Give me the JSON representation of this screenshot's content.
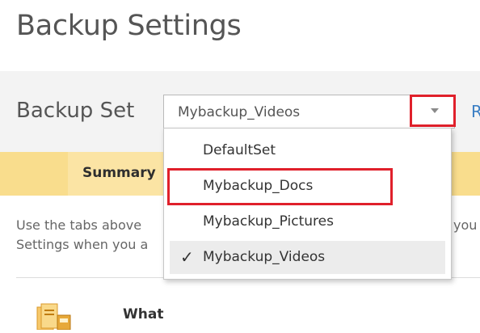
{
  "page": {
    "title": "Backup Settings"
  },
  "backup_set": {
    "label": "Backup Set",
    "selected_value": "Mybackup_Videos",
    "options": [
      {
        "label": "DefaultSet",
        "checked": false
      },
      {
        "label": "Mybackup_Docs",
        "checked": false
      },
      {
        "label": "Mybackup_Pictures",
        "checked": false
      },
      {
        "label": "Mybackup_Videos",
        "checked": true
      }
    ],
    "check_glyph": "✓"
  },
  "side_link": {
    "label": "R"
  },
  "tabs": [
    {
      "label": "Summary",
      "active": true
    }
  ],
  "intro": {
    "line1": "Use the tabs above",
    "line1_end": "you",
    "line2": "Settings when you a"
  },
  "section": {
    "what_label": "What",
    "icon": "backup-files-icon"
  },
  "colors": {
    "accent_red": "#e0202b",
    "tab_bar": "#f9dd8d",
    "link_blue": "#3b7fc4"
  }
}
